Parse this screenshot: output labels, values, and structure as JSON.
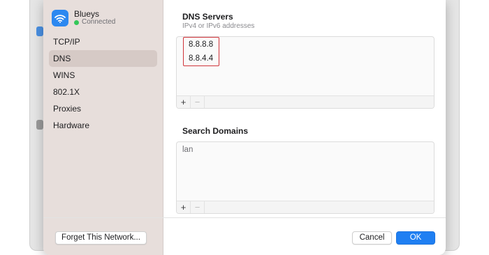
{
  "network": {
    "name": "Blueys",
    "status": "Connected",
    "status_color": "#34c759",
    "icon": "wifi-icon"
  },
  "sidebar": {
    "items": [
      {
        "label": "TCP/IP",
        "selected": false
      },
      {
        "label": "DNS",
        "selected": true
      },
      {
        "label": "WINS",
        "selected": false
      },
      {
        "label": "802.1X",
        "selected": false
      },
      {
        "label": "Proxies",
        "selected": false
      },
      {
        "label": "Hardware",
        "selected": false
      }
    ]
  },
  "dns": {
    "title": "DNS Servers",
    "subtitle": "IPv4 or IPv6 addresses",
    "servers": [
      "8.8.8.8",
      "8.8.4.4"
    ],
    "add_label": "+",
    "remove_label": "−"
  },
  "search_domains": {
    "title": "Search Domains",
    "entries": [
      "lan"
    ],
    "add_label": "+",
    "remove_label": "−"
  },
  "footer": {
    "forget_label": "Forget This Network...",
    "cancel_label": "Cancel",
    "ok_label": "OK"
  },
  "colors": {
    "accent": "#1f7ff2",
    "highlight": "#d0343a",
    "sidebar_bg": "#e7dedb"
  }
}
